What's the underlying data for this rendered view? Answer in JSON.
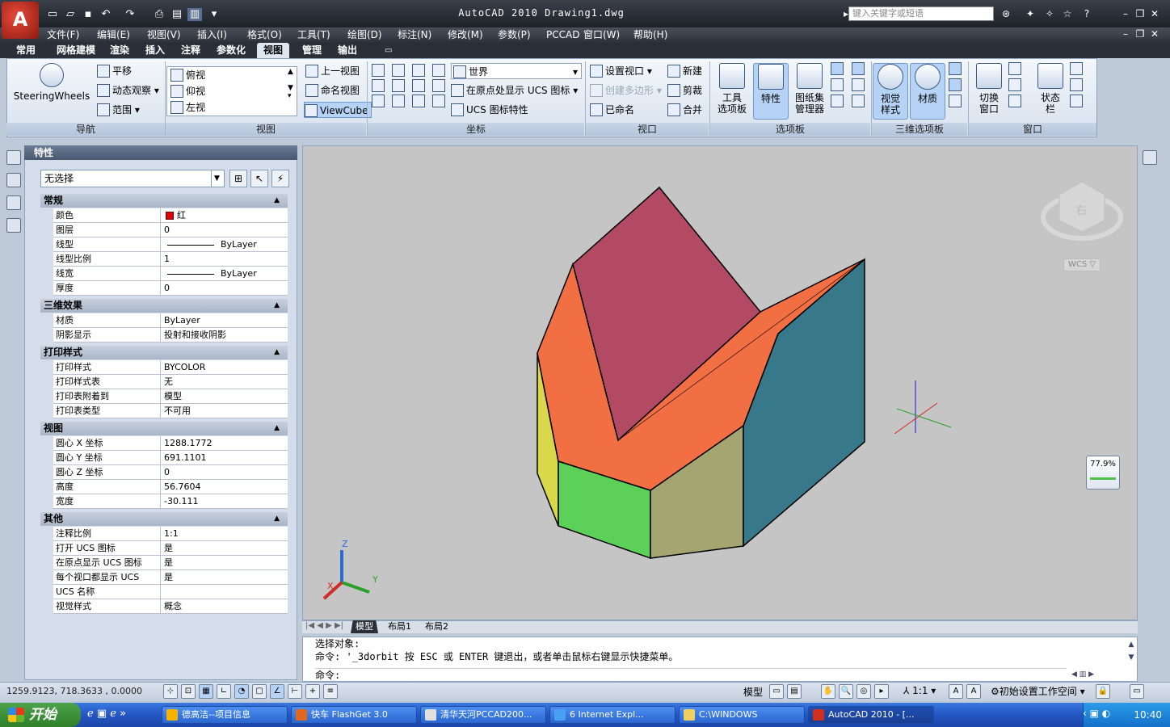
{
  "app": {
    "title": "AutoCAD 2010  Drawing1.dwg",
    "search_placeholder": "键入关键字或短语",
    "logo_letter": "A"
  },
  "menubar": [
    "文件(F)",
    "编辑(E)",
    "视图(V)",
    "插入(I)",
    "格式(O)",
    "工具(T)",
    "绘图(D)",
    "标注(N)",
    "修改(M)",
    "参数(P)",
    "PCCAD",
    "窗口(W)",
    "帮助(H)"
  ],
  "ribbon_tabs": [
    "常用",
    "网格建模",
    "渲染",
    "插入",
    "注释",
    "参数化",
    "视图",
    "管理",
    "输出"
  ],
  "active_tab": "视图",
  "ribbon": {
    "nav": {
      "steering": "SteeringWheels",
      "pan": "平移",
      "orbit": "动态观察",
      "range": "范围",
      "panel": "导航"
    },
    "views": {
      "list": [
        "俯视",
        "仰视",
        "左视"
      ],
      "prev": "上一视图",
      "named": "命名视图",
      "viewcube": "ViewCube",
      "panel": "视图"
    },
    "coords": {
      "world": "世界",
      "ucs_origin": "在原点处显示 UCS 图标",
      "ucs_props": "UCS 图标特性",
      "panel": "坐标"
    },
    "viewport": {
      "set": "设置视口",
      "poly": "创建多边形",
      "named": "已命名",
      "new": "新建",
      "clip": "剪裁",
      "join": "合并",
      "panel": "视口"
    },
    "palettes": {
      "tool": "工具\n选项板",
      "props": "特性",
      "sheetset": "图纸集\n管理器",
      "panel": "选项板"
    },
    "palettes3d": {
      "visual": "视觉\n样式",
      "material": "材质",
      "panel": "三维选项板"
    },
    "window": {
      "switch": "切换\n窗口",
      "status": "状态\n栏",
      "panel": "窗口"
    }
  },
  "props": {
    "title": "特性",
    "selection": "无选择",
    "sections": [
      {
        "name": "常规",
        "rows": [
          [
            "颜色",
            "红"
          ],
          [
            "图层",
            "0"
          ],
          [
            "线型",
            "ByLayer"
          ],
          [
            "线型比例",
            "1"
          ],
          [
            "线宽",
            "ByLayer"
          ],
          [
            "厚度",
            "0"
          ]
        ]
      },
      {
        "name": "三维效果",
        "rows": [
          [
            "材质",
            "ByLayer"
          ],
          [
            "阴影显示",
            "投射和接收阴影"
          ]
        ]
      },
      {
        "name": "打印样式",
        "rows": [
          [
            "打印样式",
            "BYCOLOR"
          ],
          [
            "打印样式表",
            "无"
          ],
          [
            "打印表附着到",
            "模型"
          ],
          [
            "打印表类型",
            "不可用"
          ]
        ]
      },
      {
        "name": "视图",
        "rows": [
          [
            "圆心 X 坐标",
            "1288.1772"
          ],
          [
            "圆心 Y 坐标",
            "691.1101"
          ],
          [
            "圆心 Z 坐标",
            "0"
          ],
          [
            "高度",
            "56.7604"
          ],
          [
            "宽度",
            "-30.111"
          ]
        ]
      },
      {
        "name": "其他",
        "rows": [
          [
            "注释比例",
            "1:1"
          ],
          [
            "打开 UCS 图标",
            "是"
          ],
          [
            "在原点显示 UCS 图标",
            "是"
          ],
          [
            "每个视口都显示 UCS",
            "是"
          ],
          [
            "UCS 名称",
            ""
          ],
          [
            "视觉样式",
            "概念"
          ]
        ]
      }
    ],
    "color_swatch": "#e00000"
  },
  "viewport": {
    "viewcube_label": "右",
    "wcs": "WCS",
    "zoom": "77.9%",
    "axis": {
      "x": "X",
      "y": "Y",
      "z": "Z"
    },
    "face_colors": {
      "top": "#b24a64",
      "orange": "#f26e43",
      "teal": "#37788a",
      "green": "#5cd058",
      "olive": "#a5a572",
      "yellow": "#d8d84a"
    }
  },
  "layout_tabs": [
    "模型",
    "布局1",
    "布局2"
  ],
  "command": {
    "line1": "选择对象:",
    "line2": "命令: '_3dorbit 按 ESC 或 ENTER 键退出，或者单击鼠标右键显示快捷菜单。",
    "prompt": "命令:"
  },
  "status": {
    "coords": "1259.9123, 718.3633 , 0.0000",
    "model": "模型",
    "scale": "1:1",
    "workspace": "初始设置工作空间"
  },
  "taskbar": {
    "start": "开始",
    "tasks": [
      "德高洁--项目信息",
      "快车 FlashGet 3.0",
      "清华天河PCCAD200...",
      "6 Internet Expl...",
      "C:\\WINDOWS",
      "AutoCAD 2010 - [..."
    ],
    "clock": "10:40"
  }
}
